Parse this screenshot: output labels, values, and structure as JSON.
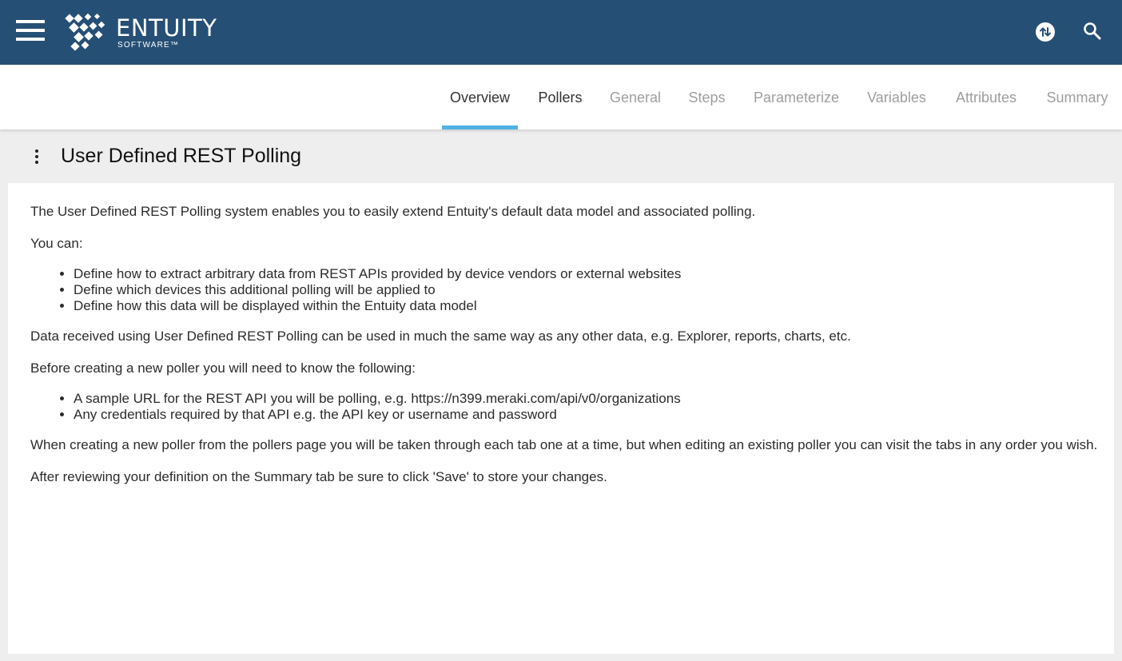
{
  "app": {
    "brand": "ENTUITY",
    "brand_sub": "SOFTWARE™",
    "header_color": "#264f75",
    "accent_color": "#4fb3e6",
    "icons": [
      "menu-icon",
      "entuity-logo-icon",
      "sync-icon",
      "search-icon"
    ]
  },
  "tabs": [
    {
      "label": "Overview",
      "state": "active"
    },
    {
      "label": "Pollers",
      "state": "enabled"
    },
    {
      "label": "General",
      "state": "disabled"
    },
    {
      "label": "Steps",
      "state": "disabled"
    },
    {
      "label": "Parameterize",
      "state": "disabled"
    },
    {
      "label": "Variables",
      "state": "disabled"
    },
    {
      "label": "Attributes",
      "state": "disabled"
    },
    {
      "label": "Summary",
      "state": "disabled"
    }
  ],
  "page": {
    "title": "User Defined REST Polling",
    "intro": "The User Defined REST Polling system enables you to easily extend Entuity's default data model and associated polling.",
    "you_can": "You can:",
    "capabilities": [
      "Define how to extract arbitrary data from REST APIs provided by device vendors or external websites",
      "Define which devices this additional polling will be applied to",
      "Define how this data will be displayed within the Entuity data model"
    ],
    "data_usage": "Data received using User Defined REST Polling can be used in much the same way as any other data, e.g. Explorer, reports, charts, etc.",
    "before_creating": "Before creating a new poller you will need to know the following:",
    "requirements": [
      "A sample URL for the REST API you will be polling, e.g. https://n399.meraki.com/api/v0/organizations",
      "Any credentials required by that API e.g. the API key or username and password"
    ],
    "workflow": "When creating a new poller from the pollers page you will be taken through each tab one at a time, but when editing an existing poller you can visit the tabs in any order you wish.",
    "save_note": "After reviewing your definition on the Summary tab be sure to click 'Save' to store your changes."
  }
}
